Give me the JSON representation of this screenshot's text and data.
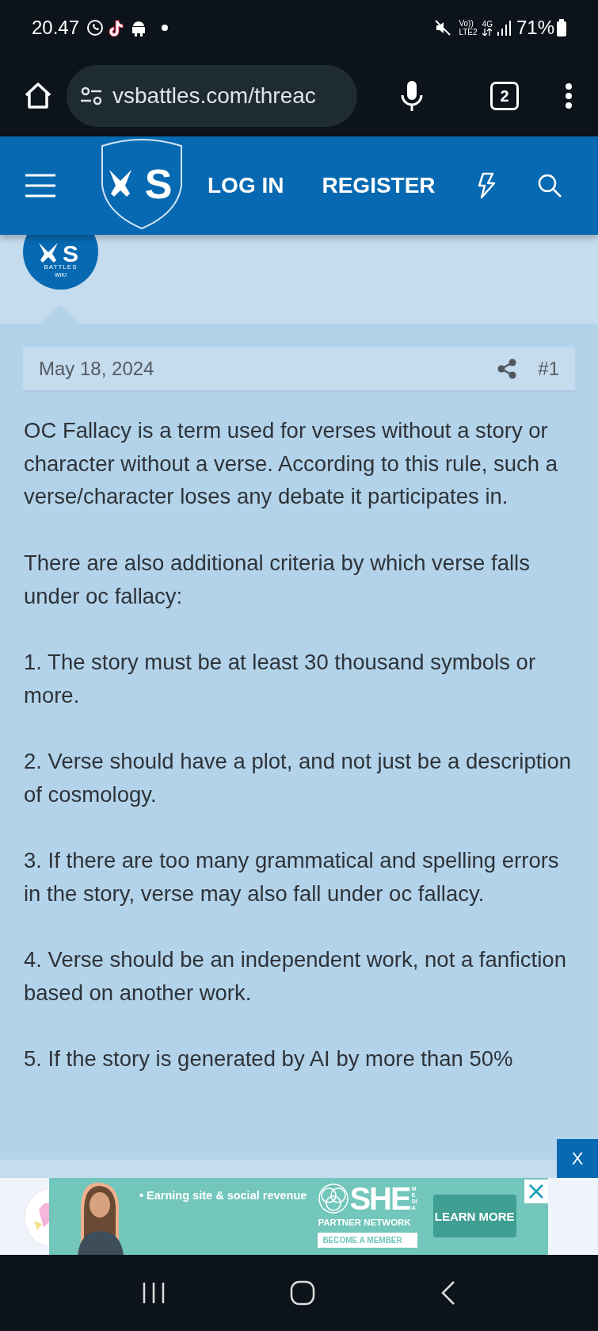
{
  "status_bar": {
    "time": "20.47",
    "network_top": "Vo))",
    "network_bottom": "LTE2",
    "data_type": "4G",
    "battery": "71%"
  },
  "browser": {
    "url": "vsbattles.com/threac",
    "tab_count": "2"
  },
  "header": {
    "logo_letter": "S",
    "links": [
      "LOG IN",
      "REGISTER"
    ]
  },
  "post": {
    "avatar_letter": "S",
    "avatar_line1": "BATTLES",
    "avatar_line2": "WIKI",
    "date": "May 18, 2024",
    "number": "#1",
    "paragraphs": [
      "OC Fallacy is a term used for verses without a story or character without a verse. According to this rule, such a verse/character loses any debate it participates in.",
      "There are also additional criteria by which verse falls under oc fallacy:",
      "1. The story must be at least 30 thousand symbols or more.",
      "2. Verse should have a plot, and not just be a description of cosmology.",
      "3. If there are too many grammatical and spelling errors in the story, verse may also fall under oc fallacy.",
      "4. Verse should be an independent work, not a fanfiction based on another work.",
      "5. If the story is generated by AI by more than 50%"
    ]
  },
  "ad": {
    "close_label": "X",
    "bullet": "• Earning site & social revenue",
    "brand": "SHE",
    "brand_side": "MEDIA",
    "network": "PARTNER NETWORK",
    "member": "BECOME A MEMBER",
    "cta": "LEARN MORE"
  }
}
